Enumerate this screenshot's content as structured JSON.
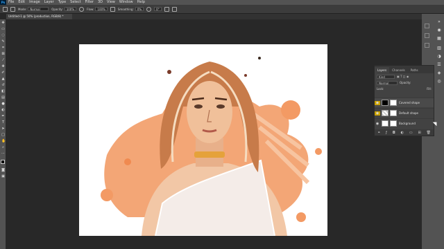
{
  "menu": {
    "logo": "Ps",
    "items": [
      "File",
      "Edit",
      "Image",
      "Layer",
      "Type",
      "Select",
      "Filter",
      "3D",
      "View",
      "Window",
      "Help"
    ]
  },
  "options": {
    "mode_label": "Mode:",
    "mode_value": "Normal",
    "opacity_label": "Opacity:",
    "opacity_value": "100%",
    "flow_label": "Flow:",
    "flow_value": "100%",
    "smoothing_label": "Smoothing:",
    "smoothing_value": "0%",
    "angle_value": "0°"
  },
  "document": {
    "tab_title": "Untitled-1 @ 50% (production, RGB/8) *"
  },
  "layers_panel": {
    "tabs": [
      "Layers",
      "Channels",
      "Paths"
    ],
    "filter_kind": "Kind",
    "blend_mode": "Normal",
    "opacity_label": "Opacity:",
    "lock_label": "Lock:",
    "fill_label": "Fill:",
    "layers": [
      {
        "name": "Covered shape",
        "highlight": "#c8a000"
      },
      {
        "name": "Default shape",
        "highlight": "#c8a000"
      },
      {
        "name": "Background",
        "highlight": ""
      }
    ]
  },
  "colors": {
    "ui_dark": "#282828",
    "ui_panel": "#424242",
    "accent_orange": "#f08a50",
    "swatch_fg": "#000000",
    "swatch_bg": "#ffffff"
  }
}
